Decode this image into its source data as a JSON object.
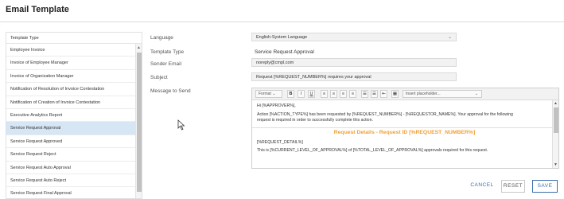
{
  "header": {
    "title": "Email Template"
  },
  "list": {
    "header": "Template Type",
    "items": [
      "Employee Invoice",
      "Invoice of Employee Manager",
      "Invoice of Organization Manager",
      "Notification of Resolution of Invoice Contestation",
      "Notification of Creation of Invoice Contestation",
      "Executive Analytics Report",
      "Service Request Approval",
      "Service Request Approved",
      "Service Request Reject",
      "Service Request Auto Approval",
      "Service Request Auto Reject",
      "Service Request Final Approval"
    ],
    "selected_index": 6
  },
  "form": {
    "language_label": "Language",
    "language_value": "English-System Language",
    "template_type_label": "Template Type",
    "template_type_value": "Service Request Approval",
    "sender_label": "Sender Email",
    "sender_value": "noreply@cmpl.com",
    "subject_label": "Subject",
    "subject_value": "Request [%REQUEST_NUMBER%] requires your approval",
    "message_label": "Message to Send"
  },
  "editor": {
    "format_label": "Format",
    "bold": "B",
    "italic": "I",
    "underline": "U",
    "placeholder_select": "Insert placeholder...",
    "line1": "Hi [%APPROVER%],",
    "line2": "Action [%ACTION_TYPE%] has been requested by [%REQUEST_NUMBER%] - [%REQUESTOR_NAME%]. Your approval for the following",
    "line3": "request is required in order to successfully complete this action.",
    "details_title": "Request Details - Request ID [%REQUEST_NUMBER%]",
    "line4": "[%REQUEST_DETAIL%]",
    "line5": "This is [%CURRENT_LEVEL_OF_APPROVAL%] of [%TOTAL_LEVEL_OF_APPROVAL%] approvals required for this request."
  },
  "buttons": {
    "cancel": "CANCEL",
    "reset": "RESET",
    "save": "SAVE"
  },
  "colors": {
    "accent": "#3a6fb0",
    "selected_row": "#d6e6f5",
    "details_title": "#f0a035"
  }
}
